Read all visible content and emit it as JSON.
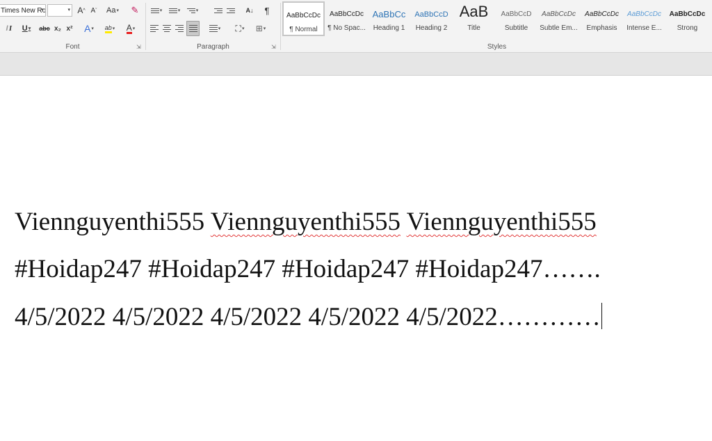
{
  "ribbon": {
    "font": {
      "label": "Font",
      "font_name": "Times New Ro",
      "font_size": "",
      "grow_glyph": "A",
      "shrink_glyph": "A",
      "case_glyph": "Aa",
      "bold": "B",
      "italic": "I",
      "underline": "U",
      "strike": "abc",
      "subscript": "x₂",
      "superscript": "x²",
      "effects_glyph": "A",
      "highlight_glyph": "ab",
      "font_color_glyph": "A",
      "highlight_color": "#ffea00",
      "font_color": "#e81c1c"
    },
    "paragraph": {
      "label": "Paragraph",
      "sort_glyph": "A↓",
      "pilcrow": "¶"
    },
    "styles": {
      "label": "Styles",
      "items": [
        {
          "sample": "AaBbCcDc",
          "name": "¶ Normal"
        },
        {
          "sample": "AaBbCcDc",
          "name": "¶ No Spac..."
        },
        {
          "sample": "AaBbCc",
          "name": "Heading 1"
        },
        {
          "sample": "AaBbCcD",
          "name": "Heading 2"
        },
        {
          "sample": "AaB",
          "name": "Title"
        },
        {
          "sample": "AaBbCcD",
          "name": "Subtitle"
        },
        {
          "sample": "AaBbCcDc",
          "name": "Subtle Em..."
        },
        {
          "sample": "AaBbCcDc",
          "name": "Emphasis"
        },
        {
          "sample": "AaBbCcDc",
          "name": "Intense E..."
        },
        {
          "sample": "AaBbCcDc",
          "name": "Strong"
        }
      ]
    }
  },
  "document": {
    "line1_words": [
      "Viennguyenthi555",
      "Viennguyenthi555",
      "Viennguyenthi555"
    ],
    "line2": "#Hoidap247 #Hoidap247 #Hoidap247 #Hoidap247…….",
    "line3": "4/5/2022 4/5/2022 4/5/2022 4/5/2022 4/5/2022…………"
  }
}
